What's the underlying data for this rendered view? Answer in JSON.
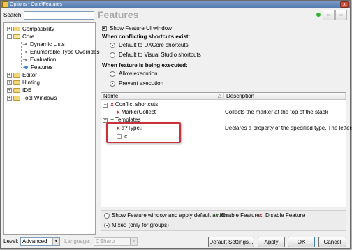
{
  "window": {
    "title": "Options - Core\\Features",
    "close_glyph": "x"
  },
  "search": {
    "label": "Search:",
    "value": "",
    "placeholder": ""
  },
  "page": {
    "heading": "Features",
    "status_color": "#2fb62f"
  },
  "nav": {
    "back_glyph": "⇦",
    "forward_glyph": "⇨"
  },
  "tree": {
    "items": [
      {
        "label": "Compatibility",
        "expander": "+"
      },
      {
        "label": "Core",
        "expander": "−"
      },
      {
        "label": "Dynamic Lists"
      },
      {
        "label": "Enumerable Type Overrides"
      },
      {
        "label": "Evaluation"
      },
      {
        "label": "Features",
        "selected": true
      },
      {
        "label": "Editor",
        "expander": "+"
      },
      {
        "label": "Hinting",
        "expander": "+"
      },
      {
        "label": "IDE",
        "expander": "+"
      },
      {
        "label": "Tool Windows",
        "expander": "+"
      }
    ]
  },
  "options": {
    "show_feature_ui": {
      "label": "Show Feature UI window",
      "checked": true,
      "mark": "✔"
    },
    "conflicting": {
      "heading": "When conflicting shortcuts exist:",
      "opt1": "Default to DXCore shortcuts",
      "opt2": "Default to Visual Studio shortcuts",
      "selected": 1
    },
    "executed": {
      "heading": "When feature is being executed:",
      "opt1": "Allow execution",
      "opt2": "Prevent execution",
      "selected": 2
    }
  },
  "grid": {
    "columns": {
      "name": "Name",
      "description": "Description",
      "sort_glyph": "△"
    },
    "rows": [
      {
        "expander": "−",
        "mark": "x",
        "name": "Conflict shortcuts",
        "description": ""
      },
      {
        "expander": "",
        "mark": "x",
        "name": "MarkerCollect",
        "description": "Collects the marker at the top of the stack"
      },
      {
        "expander": "−",
        "mark": "+",
        "name": "Templates",
        "description": ""
      },
      {
        "expander": "",
        "mark": "x",
        "name": "a?Type?",
        "description": "Declares a property of the specified type. The letters f..."
      },
      {
        "expander": "",
        "mark": "",
        "name": "c",
        "description": ""
      }
    ]
  },
  "actions": {
    "show_feature_window": "Show Feature window and apply default action",
    "enable_feature": "Enable Feature",
    "disable_feature": "Disable Feature",
    "mixed": "Mixed (only for groups)",
    "enable_mark": "✔",
    "disable_mark": "x"
  },
  "footer": {
    "level_label": "Level:",
    "level_value": "Advanced",
    "language_label": "Language:",
    "language_value": "CSharp",
    "dropdown_arrow": "▼",
    "default_settings": "Default Settings...",
    "apply": "Apply",
    "ok": "OK",
    "cancel": "Cancel"
  }
}
